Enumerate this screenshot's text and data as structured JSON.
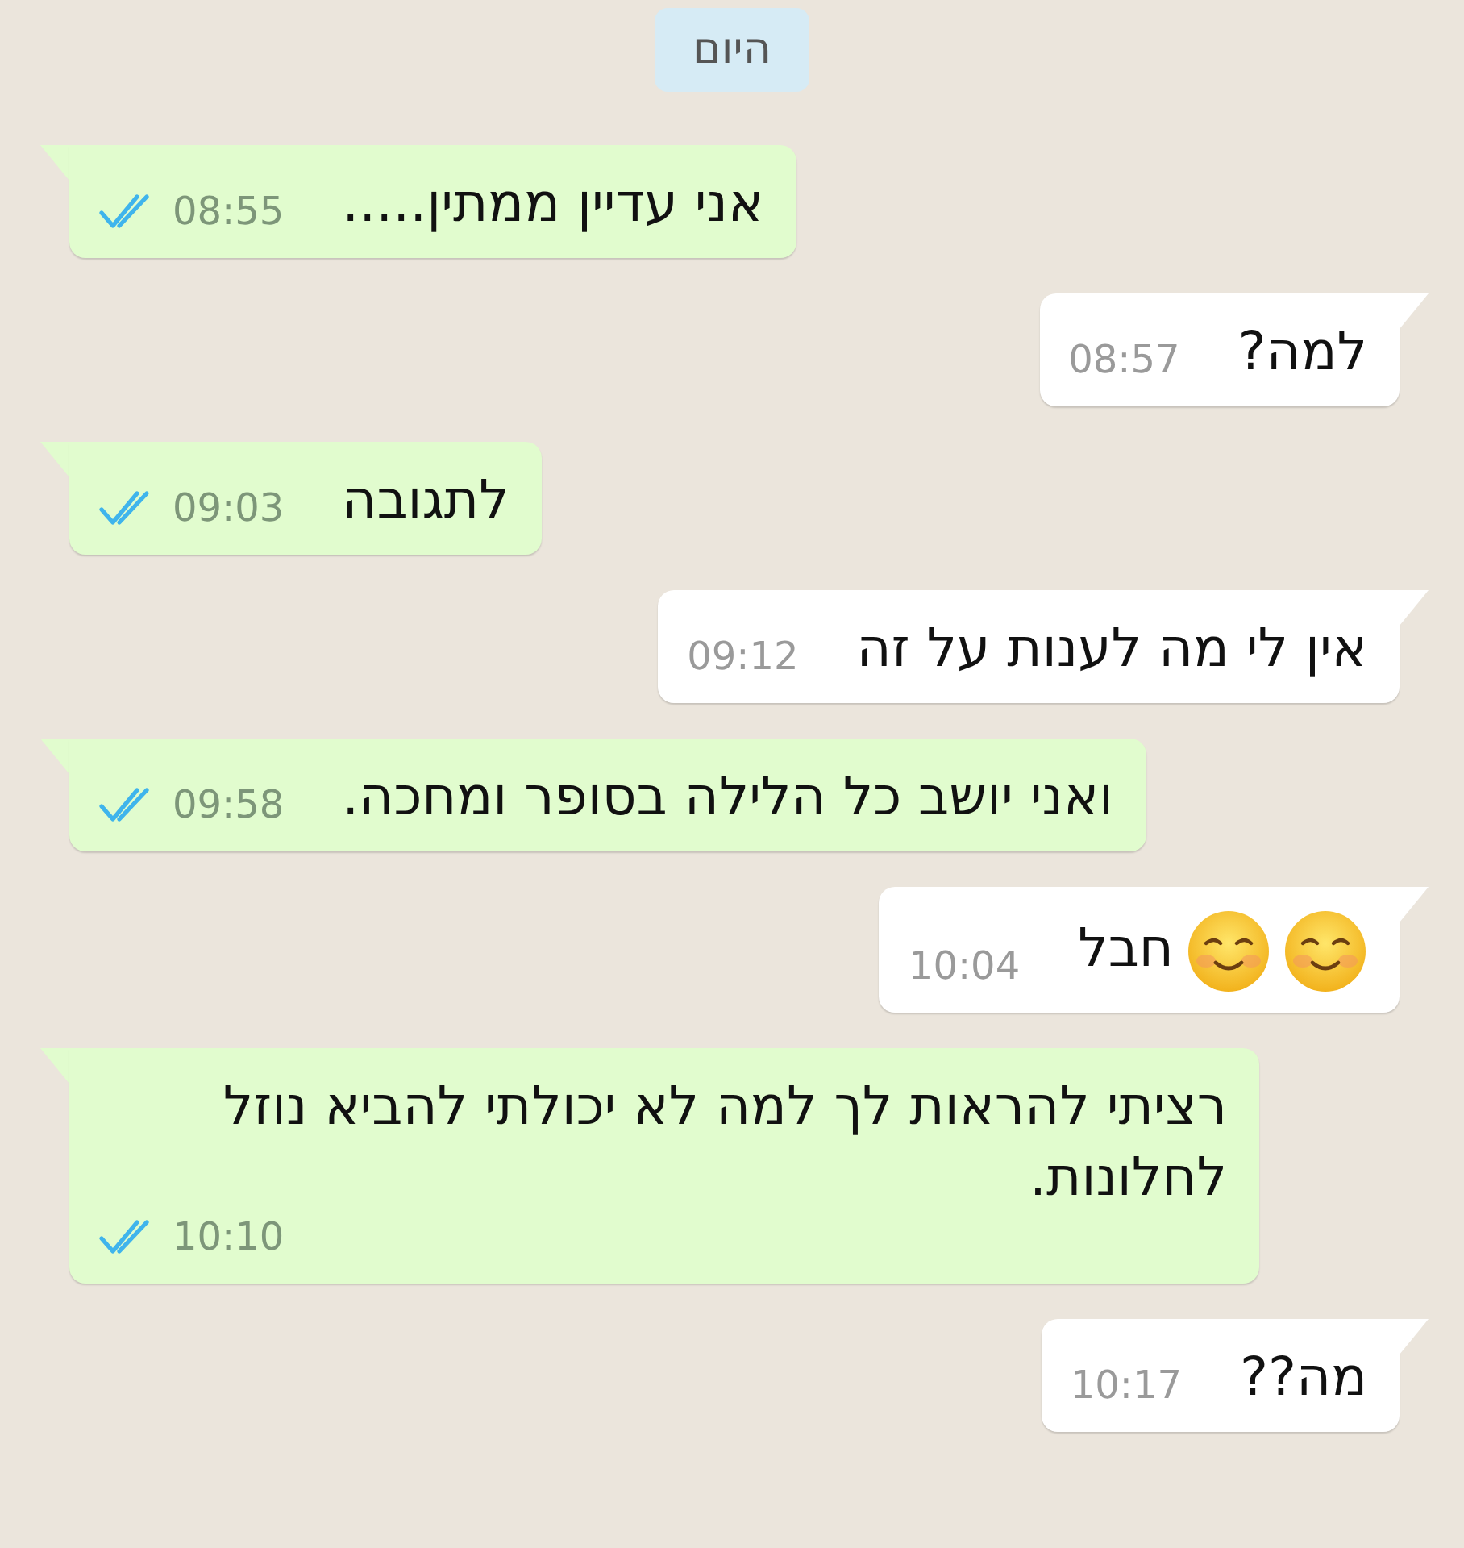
{
  "date_chip": "היום",
  "messages": [
    {
      "kind": "sent",
      "text": "אני עדיין ממתין.....",
      "time": "08:55",
      "read": true
    },
    {
      "kind": "received",
      "text": "למה?",
      "time": "08:57"
    },
    {
      "kind": "sent",
      "text": "לתגובה",
      "time": "09:03",
      "read": true
    },
    {
      "kind": "received",
      "text": "אין לי מה לענות על זה",
      "time": "09:12"
    },
    {
      "kind": "sent",
      "text": "ואני יושב כל הלילה בסופר ומחכה.",
      "time": "09:58",
      "read": true
    },
    {
      "kind": "received",
      "emojis": [
        {
          "kind": "smiley"
        },
        {
          "kind": "smiley"
        }
      ],
      "text": "חבל",
      "time": "10:04"
    },
    {
      "kind": "sent",
      "text": "רציתי להראות לך למה לא יכולתי להביא נוזל לחלונות.",
      "time": "10:10",
      "read": true
    },
    {
      "kind": "received",
      "text": "מה??",
      "time": "10:17"
    }
  ]
}
